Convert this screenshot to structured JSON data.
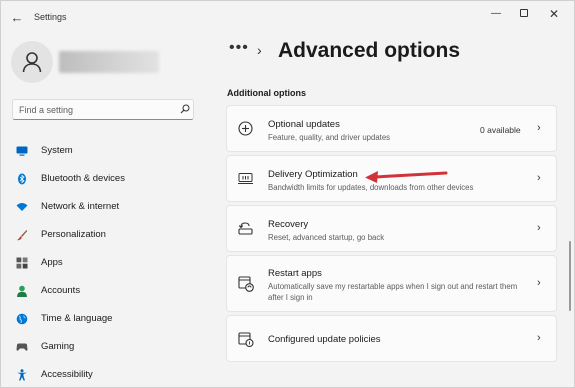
{
  "titlebar": {
    "back_glyph": "←",
    "app_title": "Settings",
    "minimize_glyph": "—",
    "close_glyph": "✕"
  },
  "search": {
    "placeholder": "Find a setting"
  },
  "nav": {
    "items": [
      {
        "label": "System",
        "icon": "system-icon",
        "color": "#0067c0"
      },
      {
        "label": "Bluetooth & devices",
        "icon": "bluetooth-icon",
        "color": "#0078d4"
      },
      {
        "label": "Network & internet",
        "icon": "wifi-icon",
        "color": "#0078d4"
      },
      {
        "label": "Personalization",
        "icon": "brush-icon",
        "color": "#c0392b"
      },
      {
        "label": "Apps",
        "icon": "apps-icon",
        "color": "#444444"
      },
      {
        "label": "Accounts",
        "icon": "person-icon",
        "color": "#2aa05b"
      },
      {
        "label": "Time & language",
        "icon": "globe-icon",
        "color": "#0078d4"
      },
      {
        "label": "Gaming",
        "icon": "gamepad-icon",
        "color": "#555555"
      },
      {
        "label": "Accessibility",
        "icon": "accessibility-icon",
        "color": "#0067c0"
      }
    ]
  },
  "breadcrumb": {
    "dots": "•••",
    "separator": "›"
  },
  "page": {
    "title": "Advanced options",
    "section": "Additional options"
  },
  "cards": [
    {
      "title": "Optional updates",
      "desc": "Feature, quality, and driver updates",
      "value": "0 available",
      "icon": "add-circle-icon"
    },
    {
      "title": "Delivery Optimization",
      "desc": "Bandwidth limits for updates, downloads from other devices",
      "icon": "delivery-optimization-icon"
    },
    {
      "title": "Recovery",
      "desc": "Reset, advanced startup, go back",
      "icon": "recovery-icon"
    },
    {
      "title": "Restart apps",
      "desc": "Automatically save my restartable apps when I sign out and restart them after I sign in",
      "icon": "restart-apps-icon"
    },
    {
      "title": "Configured update policies",
      "desc": "",
      "icon": "policy-icon"
    }
  ],
  "chevron": "›",
  "annotation_color": "#d13438"
}
